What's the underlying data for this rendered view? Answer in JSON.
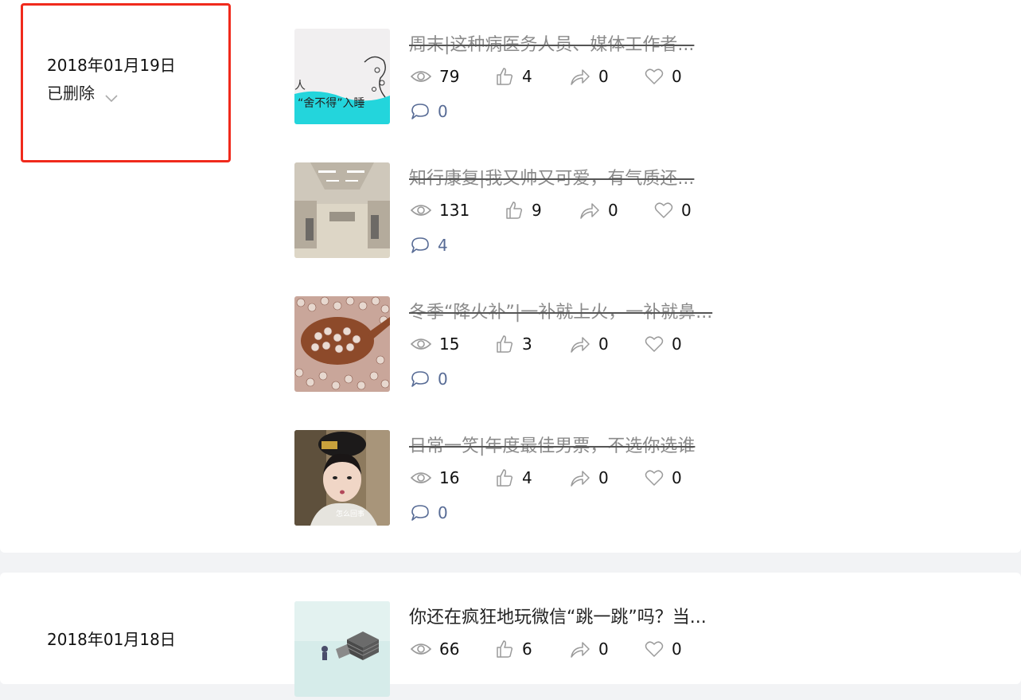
{
  "groups": [
    {
      "date": "2018年01月19日",
      "status": "已删除",
      "articles": [
        {
          "title": "周末|这种病医务人员、媒体工作者...",
          "deleted": true,
          "stats": {
            "reads": "79",
            "likes": "4",
            "shares": "0",
            "favorites": "0",
            "comments": "0"
          },
          "thumb_text": [
            "人",
            "“舍不得”入睡"
          ]
        },
        {
          "title": "知行康复|我又帅又可爱，有气质还...",
          "deleted": true,
          "stats": {
            "reads": "131",
            "likes": "9",
            "shares": "0",
            "favorites": "0",
            "comments": "4"
          }
        },
        {
          "title": "冬季“降火补”|一补就上火，一补就鼻...",
          "deleted": true,
          "stats": {
            "reads": "15",
            "likes": "3",
            "shares": "0",
            "favorites": "0",
            "comments": "0"
          }
        },
        {
          "title": "日常一笑|年度最佳男票，不选你选谁",
          "deleted": true,
          "stats": {
            "reads": "16",
            "likes": "4",
            "shares": "0",
            "favorites": "0",
            "comments": "0"
          },
          "thumb_text": [
            "怎么回事"
          ]
        }
      ]
    },
    {
      "date": "2018年01月18日",
      "articles": [
        {
          "title": "你还在疯狂地玩微信“跳一跳”吗？当...",
          "deleted": false,
          "stats": {
            "reads": "66",
            "likes": "6",
            "shares": "0",
            "favorites": "0"
          }
        }
      ]
    }
  ],
  "icons": [
    "eye-icon",
    "thumbs-up-icon",
    "share-icon",
    "heart-icon",
    "comment-icon",
    "chevron-down-icon"
  ],
  "colors": {
    "highlight_border": "#f02a1c",
    "comment_count": "#576b95",
    "icon_gray": "#9a9a9a",
    "comment_icon": "#576b95",
    "page_bg": "#f2f3f5"
  }
}
